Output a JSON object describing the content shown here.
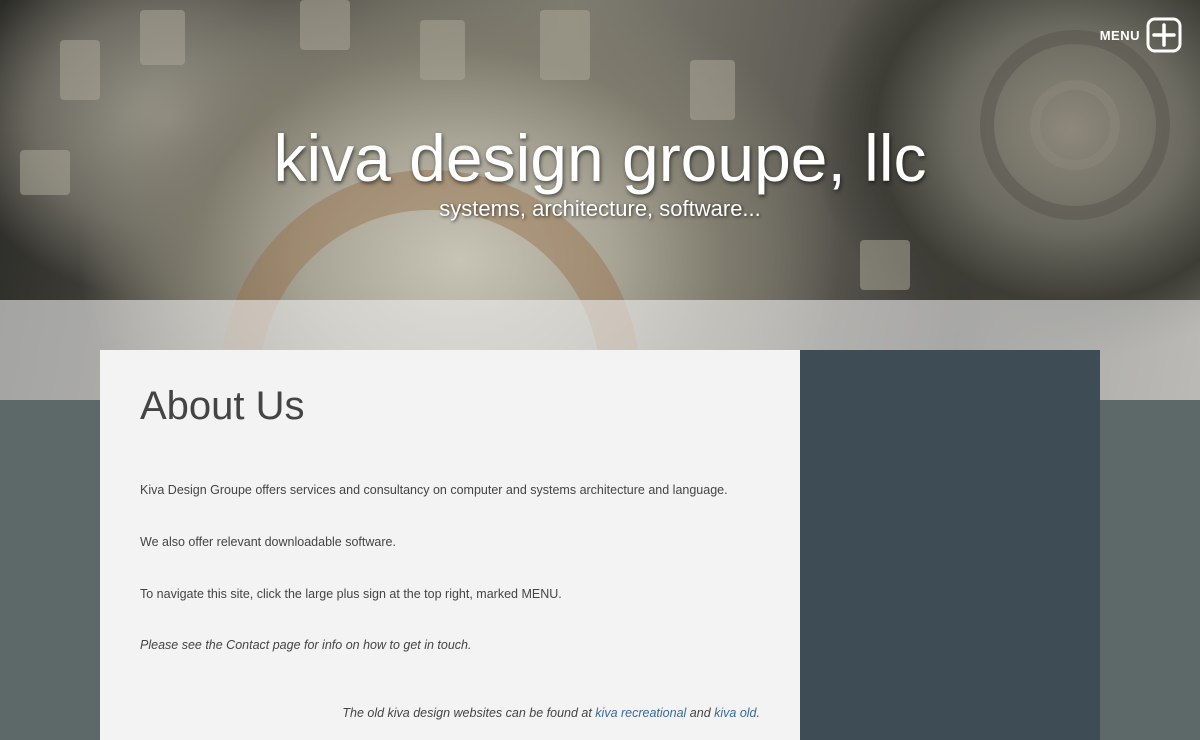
{
  "header": {
    "menu_label": "MENU",
    "menu_icon": "plus-square-icon",
    "site_title": "kiva design groupe, llc",
    "tagline": "systems, architecture, software..."
  },
  "main": {
    "heading": "About Us",
    "paragraphs": [
      "Kiva Design Groupe offers services and consultancy on computer and systems architecture and language.",
      "We also offer relevant downloadable software.",
      "To navigate this site, click the large plus sign at the top right, marked MENU.",
      "Please see the Contact page for info on how to get in touch."
    ],
    "footer": {
      "prefix": "The old kiva design websites can be found at ",
      "link1": "kiva recreational",
      "middle": " and ",
      "link2": "kiva old",
      "suffix": "."
    }
  },
  "colors": {
    "page_background": "#5d6868",
    "content_background": "#f3f3f3",
    "sidebar_background": "#3e4c55",
    "link": "#3a6a9a",
    "text": "#444444"
  }
}
